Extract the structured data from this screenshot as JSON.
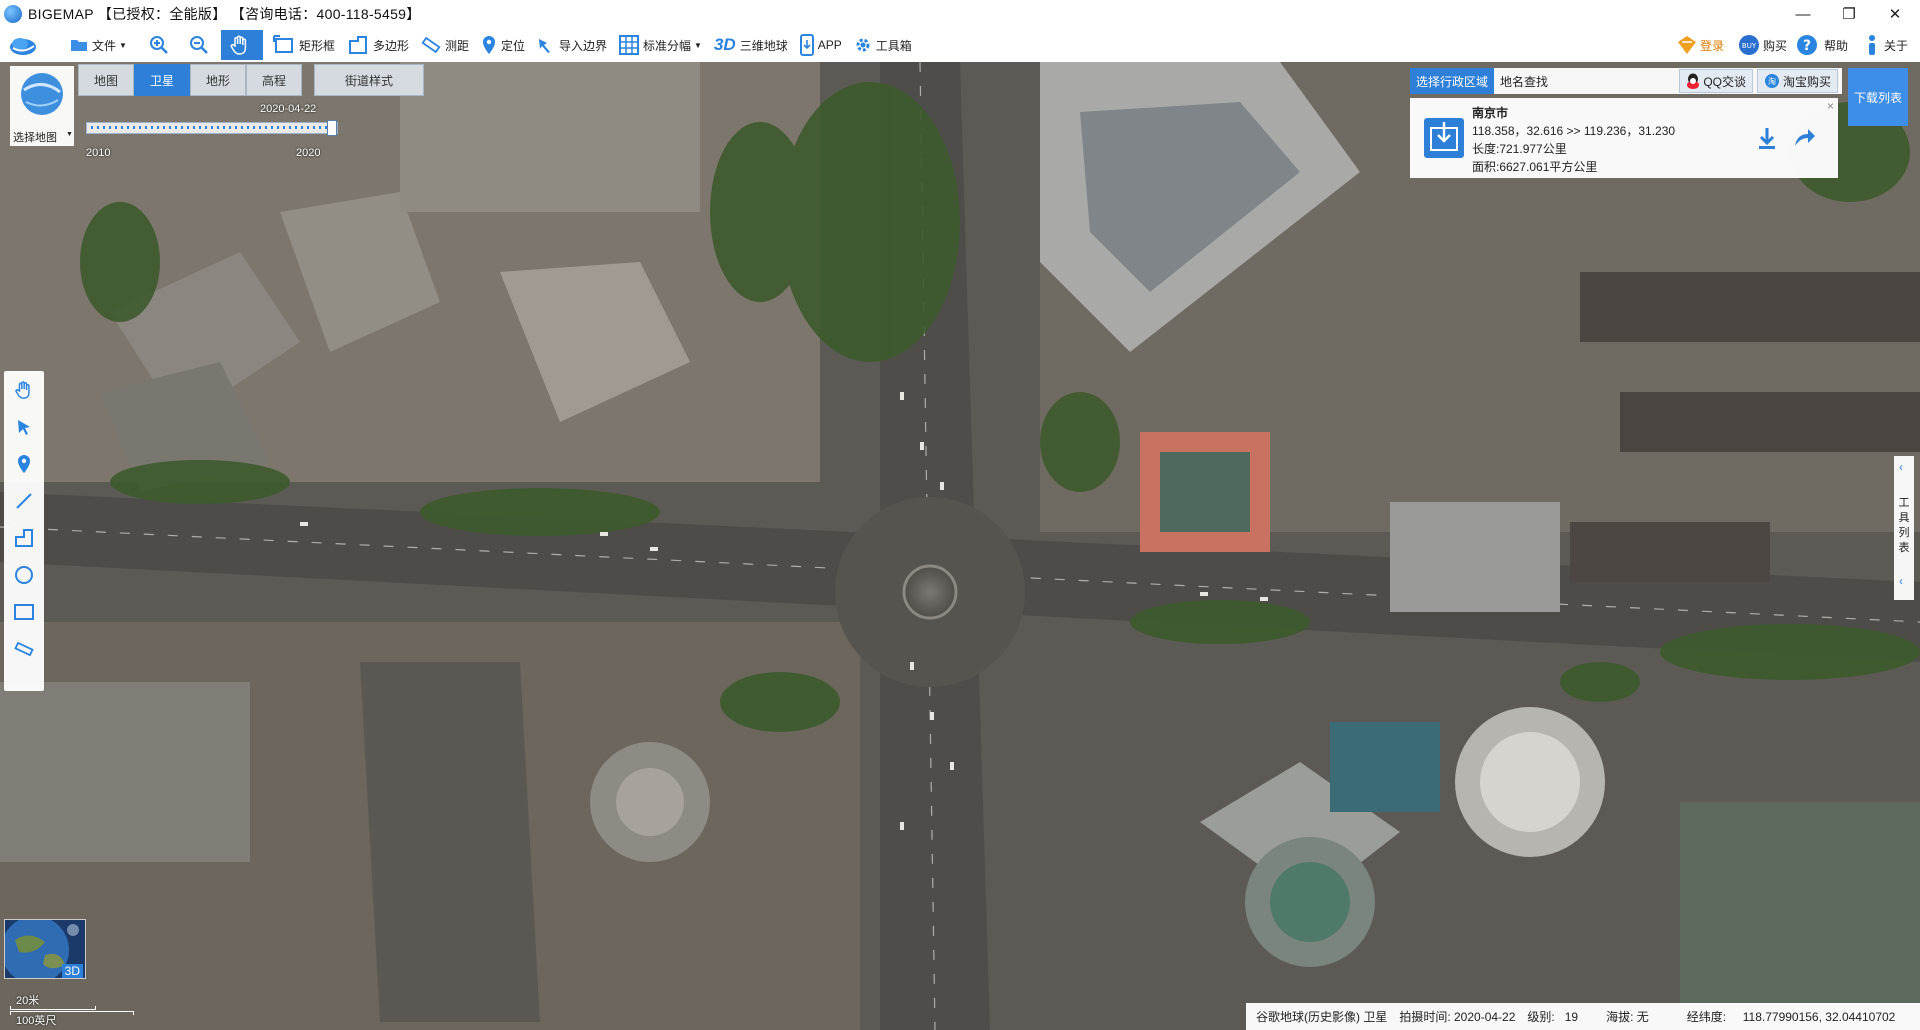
{
  "window": {
    "title": "BIGEMAP 【已授权：全能版】 【咨询电话：400-118-5459】",
    "controls": [
      "—",
      "❐",
      "✕"
    ]
  },
  "toolbar": {
    "file": "文件",
    "rect": "矩形框",
    "polygon": "多边形",
    "measure": "测距",
    "locate": "定位",
    "import_boundary": "导入边界",
    "grid": "标准分幅",
    "three_d_label": "3D",
    "globe": "三维地球",
    "app": "APP",
    "toolbox": "工具箱",
    "login": "登录",
    "buy": "购买",
    "help": "帮助",
    "about": "关于"
  },
  "map_selector": {
    "label": "选择地图",
    "tabs": [
      "地图",
      "卫星",
      "地形",
      "高程"
    ],
    "selected_tab": "卫星",
    "street_style": "街道样式"
  },
  "timeline": {
    "current_date": "2020-04-22",
    "start_year": "2010",
    "end_year": "2020",
    "position": 1.0
  },
  "region_panel": {
    "tab_admin": "选择行政区域",
    "tab_search": "地名查找",
    "qq": "QQ交谈",
    "taobao": "淘宝购买",
    "download_list": "下载列表",
    "city": "南京市",
    "coords": "118.358，32.616 >> 119.236，31.230",
    "length": "长度:721.977公里",
    "area": "面积:6627.061平方公里",
    "close": "×"
  },
  "tool_list": {
    "label_chars": [
      "工",
      "具",
      "列",
      "表"
    ]
  },
  "minimap": {
    "label": "3D"
  },
  "scale": {
    "metric": "20米",
    "imperial": "100英尺"
  },
  "status": {
    "source": "谷歌地球(历史影像) 卫星",
    "date_label": "拍摄时间: 2020-04-22",
    "level": "级别:   19",
    "elevation": "海拔: 无",
    "coords": "经纬度:     118.77990156, 32.04410702"
  },
  "colors": {
    "accent": "#2d7fd8",
    "download_btn": "#3d8ee8",
    "login_icon": "#f0a020"
  }
}
